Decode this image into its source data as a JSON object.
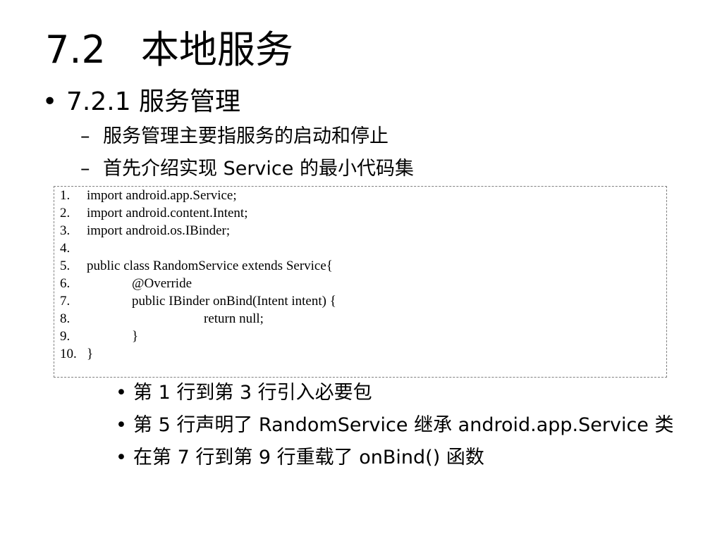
{
  "slide": {
    "title_number": "7.2",
    "title_text": "本地服务",
    "bullet_glyph": "•",
    "dash_glyph": "–",
    "section": {
      "label": "7.2.1  服务管理",
      "sub_items": [
        "服务管理主要指服务的启动和停止",
        "首先介绍实现 Service 的最小代码集"
      ]
    },
    "code": {
      "lines": [
        {
          "num": "1.",
          "text": "import android.app.Service;",
          "indent": 0
        },
        {
          "num": "2.",
          "text": "import android.content.Intent;",
          "indent": 0
        },
        {
          "num": "3.",
          "text": "import android.os.IBinder;",
          "indent": 0
        },
        {
          "num": "4.",
          "text": "",
          "indent": 0
        },
        {
          "num": "5.",
          "text": "public class RandomService extends Service{",
          "indent": 0
        },
        {
          "num": "6.",
          "text": "@Override",
          "indent": 1
        },
        {
          "num": "7.",
          "text": "public IBinder onBind(Intent intent) {",
          "indent": 1
        },
        {
          "num": "8.",
          "text": "return null;",
          "indent": 2
        },
        {
          "num": "9.",
          "text": "}",
          "indent": 1
        },
        {
          "num": "10.",
          "text": "}",
          "indent": 0
        }
      ]
    },
    "notes": [
      "第 1 行到第 3 行引入必要包",
      "第 5 行声明了 RandomService 继承 android.app.Service 类",
      "在第 7 行到第 9 行重载了 onBind() 函数"
    ]
  }
}
